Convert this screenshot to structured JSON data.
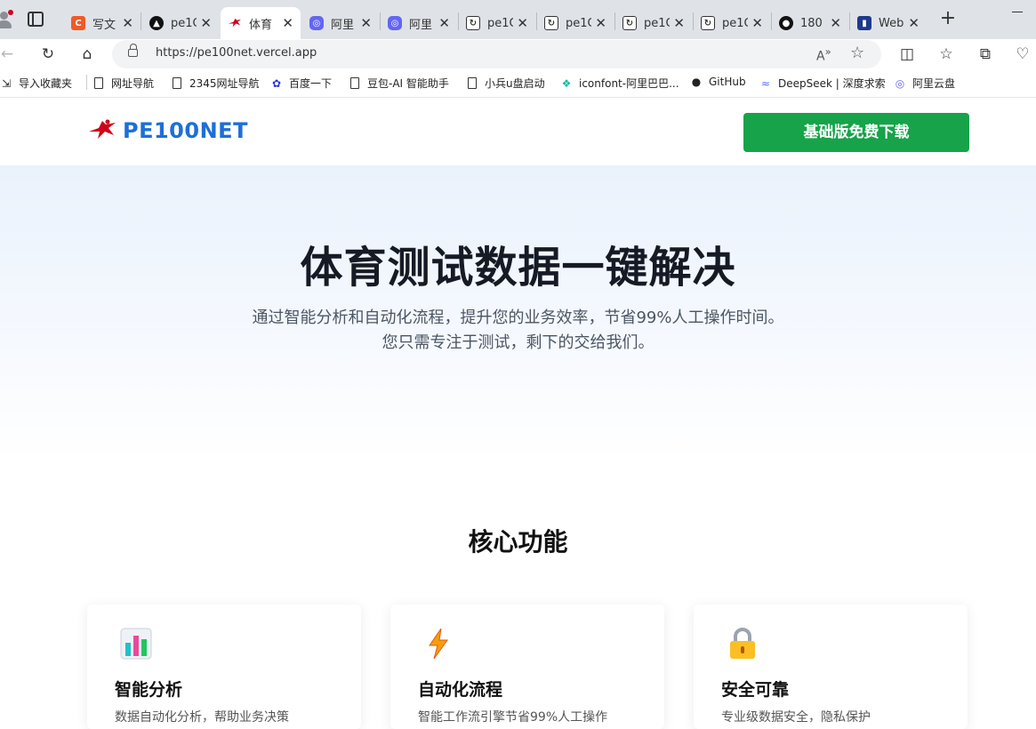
{
  "browser": {
    "tabs": [
      {
        "title": "写文",
        "favicon": "c-logo-icon",
        "color": "#f05a28"
      },
      {
        "title": "pe1C",
        "favicon": "triangle-logo-icon",
        "color": "#111111"
      },
      {
        "title": "体育",
        "favicon": "pe100net-logo-icon",
        "color": "#d0021b",
        "active": true
      },
      {
        "title": "阿里",
        "favicon": "aliyun-drive-icon",
        "color": "#6366f1"
      },
      {
        "title": "阿里",
        "favicon": "aliyun-drive-icon",
        "color": "#6366f1"
      },
      {
        "title": "pe1C",
        "favicon": "doc-icon",
        "color": "#333333"
      },
      {
        "title": "pe1C",
        "favicon": "doc-icon",
        "color": "#333333"
      },
      {
        "title": "pe1C",
        "favicon": "doc-icon",
        "color": "#333333"
      },
      {
        "title": "pe1C",
        "favicon": "doc-icon",
        "color": "#333333"
      },
      {
        "title": "180",
        "favicon": "github-icon",
        "color": "#111111"
      },
      {
        "title": "Web",
        "favicon": "web-icon",
        "color": "#1e3a8a"
      }
    ],
    "url": "https://pe100net.vercel.app",
    "bookmarks": [
      {
        "label": "导入收藏夹",
        "icon": "import-icon"
      },
      {
        "label": "网址导航",
        "icon": "page-icon"
      },
      {
        "label": "2345网址导航",
        "icon": "page-icon"
      },
      {
        "label": "百度一下",
        "icon": "baidu-icon"
      },
      {
        "label": "豆包-AI 智能助手",
        "icon": "page-icon"
      },
      {
        "label": "小兵u盘启动",
        "icon": "page-icon"
      },
      {
        "label": "iconfont-阿里巴巴...",
        "icon": "iconfont-icon"
      },
      {
        "label": "GitHub",
        "icon": "github-icon"
      },
      {
        "label": "DeepSeek | 深度求索",
        "icon": "deepseek-icon"
      },
      {
        "label": "阿里云盘",
        "icon": "aliyun-drive-icon"
      }
    ]
  },
  "header": {
    "logo_text": "PE100NET",
    "download_button": "基础版免费下载",
    "brand_color": "#1d6fd8",
    "button_color": "#16a34a"
  },
  "hero": {
    "title": "体育测试数据一键解决",
    "subtitle_line1": "通过智能分析和自动化流程，提升您的业务效率，节省99%人工操作时间。",
    "subtitle_line2": "您只需专注于测试，剩下的交给我们。"
  },
  "features": {
    "section_title": "核心功能",
    "cards": [
      {
        "title": "智能分析",
        "icon": "bar-chart-icon",
        "desc": "数据自动化分析，帮助业务决策"
      },
      {
        "title": "自动化流程",
        "icon": "lightning-icon",
        "desc": "智能工作流引擎节省99%人工操作"
      },
      {
        "title": "安全可靠",
        "icon": "lock-icon",
        "desc": "专业级数据安全，隐私保护"
      }
    ]
  }
}
